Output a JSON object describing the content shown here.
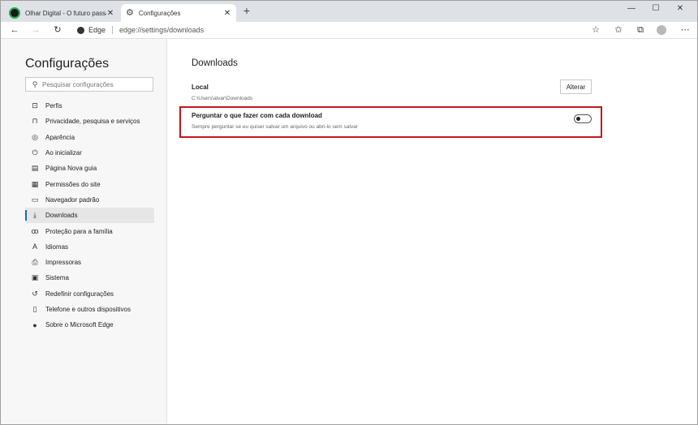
{
  "tabs": [
    {
      "title": "Olhar Digital - O futuro passa p",
      "favicon": "olhar-digital-favicon"
    },
    {
      "title": "Configurações",
      "favicon": "gear-icon",
      "active": true
    }
  ],
  "toolbar": {
    "address_brand": "Edge",
    "address_url": "edge://settings/downloads"
  },
  "sidebar": {
    "title": "Configurações",
    "search_placeholder": "Pesquisar configurações",
    "items": [
      {
        "label": "Perfis",
        "icon": "profile-icon"
      },
      {
        "label": "Privacidade, pesquisa e serviços",
        "icon": "lock-icon"
      },
      {
        "label": "Aparência",
        "icon": "palette-icon"
      },
      {
        "label": "Ao inicializar",
        "icon": "power-icon"
      },
      {
        "label": "Página Nova guia",
        "icon": "new-tab-page-icon"
      },
      {
        "label": "Permissões do site",
        "icon": "site-permissions-icon"
      },
      {
        "label": "Navegador padrão",
        "icon": "browser-icon"
      },
      {
        "label": "Downloads",
        "icon": "download-icon",
        "active": true
      },
      {
        "label": "Proteção para a família",
        "icon": "family-icon"
      },
      {
        "label": "Idiomas",
        "icon": "language-icon"
      },
      {
        "label": "Impressoras",
        "icon": "printer-icon"
      },
      {
        "label": "Sistema",
        "icon": "system-icon"
      },
      {
        "label": "Redefinir configurações",
        "icon": "reset-icon"
      },
      {
        "label": "Telefone e outros dispositivos",
        "icon": "phone-icon"
      },
      {
        "label": "Sobre o Microsoft Edge",
        "icon": "edge-logo-icon"
      }
    ]
  },
  "main": {
    "title": "Downloads",
    "location_label": "Local",
    "location_path": "C:\\Users\\alvar\\Downloads",
    "change_button": "Alterar",
    "ask_title": "Perguntar o que fazer com cada download",
    "ask_description": "Sempre perguntar se eu quiser salvar um arquivo ou abri-lo sem salvar",
    "ask_toggle_on": false
  },
  "colors": {
    "highlight_border": "#c4161c",
    "active_indicator": "#0f6cbd",
    "sidebar_bg": "#f7f7f7",
    "tabstrip_bg": "#dee1e6"
  }
}
